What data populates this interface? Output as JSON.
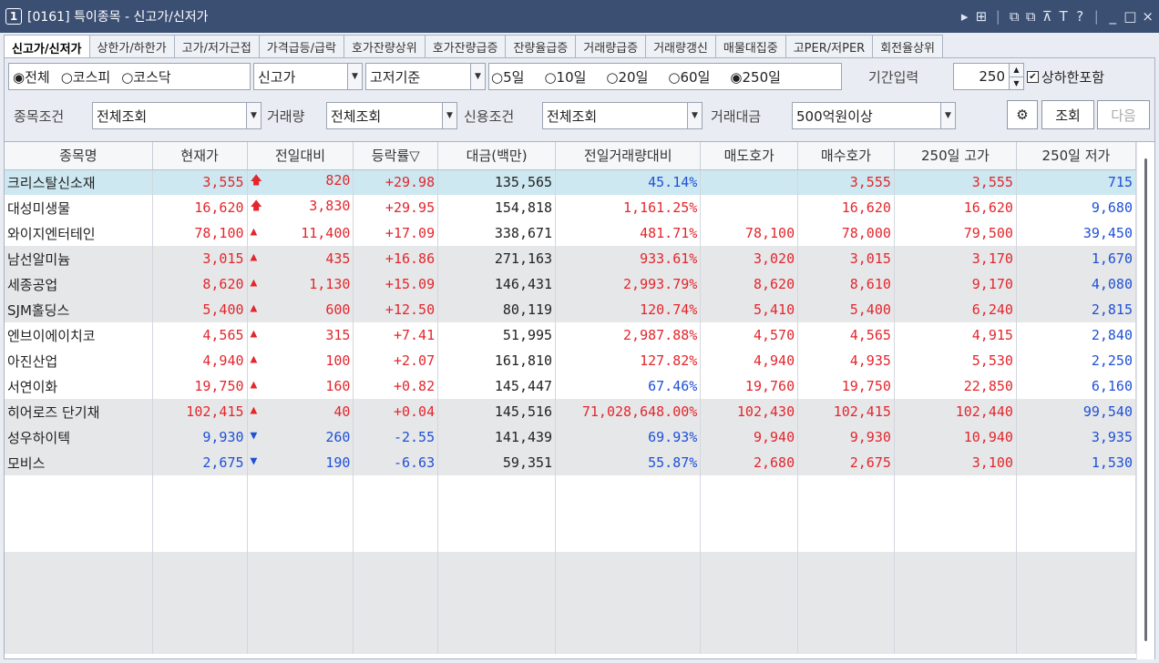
{
  "window": {
    "badge": "1",
    "title": "[0161] 특이종목 - 신고가/신저가",
    "controls": [
      "▸",
      "⊞",
      "⧉",
      "⧉",
      "⊼",
      "T",
      "?",
      "_",
      "□",
      "×"
    ]
  },
  "tabs": [
    "신고가/신저가",
    "상한가/하한가",
    "고가/저가근접",
    "가격급등/급락",
    "호가잔량상위",
    "호가잔량급증",
    "잔량율급증",
    "거래량급증",
    "거래량갱신",
    "매물대집중",
    "고PER/저PER",
    "회전율상위"
  ],
  "filters": {
    "market": [
      "◉전체",
      "○코스피",
      "○코스닥"
    ],
    "type_value": "신고가",
    "basis_value": "고저기준",
    "periods": [
      "○5일",
      "○10일",
      "○20일",
      "○60일",
      "◉250일"
    ],
    "period_label": "기간입력",
    "period_input": "250",
    "include_limit_label": "상하한포함",
    "include_limit_checked": "✔",
    "stock_cond_label": "종목조건",
    "stock_cond_value": "전체조회",
    "volume_label": "거래량",
    "volume_value": "전체조회",
    "credit_label": "신용조건",
    "credit_value": "전체조회",
    "amount_label": "거래대금",
    "amount_value": "500억원이상",
    "search_button": "조회",
    "next_button": "다음"
  },
  "table": {
    "columns": [
      "종목명",
      "현재가",
      "전일대비",
      "등락률▽",
      "대금(백만)",
      "전일거래량대비",
      "매도호가",
      "매수호가",
      "250일 고가",
      "250일 저가"
    ],
    "rows": [
      {
        "name": "크리스탈신소재",
        "price": "3,555",
        "arrow": "🡅",
        "change": "820",
        "rate": "+29.98",
        "amount": "135,565",
        "vol_ratio": "45.14%",
        "ask": "",
        "bid": "3,555",
        "high": "3,555",
        "low": "715",
        "price_c": "red",
        "vr_c": "blue",
        "style": "hl"
      },
      {
        "name": "대성미생물",
        "price": "16,620",
        "arrow": "🡅",
        "change": "3,830",
        "rate": "+29.95",
        "amount": "154,818",
        "vol_ratio": "1,161.25%",
        "ask": "",
        "bid": "16,620",
        "high": "16,620",
        "low": "9,680",
        "price_c": "red",
        "vr_c": "red",
        "style": ""
      },
      {
        "name": "와이지엔터테인",
        "price": "78,100",
        "arrow": "▲",
        "change": "11,400",
        "rate": "+17.09",
        "amount": "338,671",
        "vol_ratio": "481.71%",
        "ask": "78,100",
        "bid": "78,000",
        "high": "79,500",
        "low": "39,450",
        "price_c": "red",
        "vr_c": "red",
        "style": ""
      },
      {
        "name": "남선알미늄",
        "price": "3,015",
        "arrow": "▲",
        "change": "435",
        "rate": "+16.86",
        "amount": "271,163",
        "vol_ratio": "933.61%",
        "ask": "3,020",
        "bid": "3,015",
        "high": "3,170",
        "low": "1,670",
        "price_c": "red",
        "vr_c": "red",
        "style": "gray"
      },
      {
        "name": "세종공업",
        "price": "8,620",
        "arrow": "▲",
        "change": "1,130",
        "rate": "+15.09",
        "amount": "146,431",
        "vol_ratio": "2,993.79%",
        "ask": "8,620",
        "bid": "8,610",
        "high": "9,170",
        "low": "4,080",
        "price_c": "red",
        "vr_c": "red",
        "style": "gray"
      },
      {
        "name": "SJM홀딩스",
        "price": "5,400",
        "arrow": "▲",
        "change": "600",
        "rate": "+12.50",
        "amount": "80,119",
        "vol_ratio": "120.74%",
        "ask": "5,410",
        "bid": "5,400",
        "high": "6,240",
        "low": "2,815",
        "price_c": "red",
        "vr_c": "red",
        "style": "gray"
      },
      {
        "name": "엔브이에이치코",
        "price": "4,565",
        "arrow": "▲",
        "change": "315",
        "rate": "+7.41",
        "amount": "51,995",
        "vol_ratio": "2,987.88%",
        "ask": "4,570",
        "bid": "4,565",
        "high": "4,915",
        "low": "2,840",
        "price_c": "red",
        "vr_c": "red",
        "style": ""
      },
      {
        "name": "아진산업",
        "price": "4,940",
        "arrow": "▲",
        "change": "100",
        "rate": "+2.07",
        "amount": "161,810",
        "vol_ratio": "127.82%",
        "ask": "4,940",
        "bid": "4,935",
        "high": "5,530",
        "low": "2,250",
        "price_c": "red",
        "vr_c": "red",
        "style": ""
      },
      {
        "name": "서연이화",
        "price": "19,750",
        "arrow": "▲",
        "change": "160",
        "rate": "+0.82",
        "amount": "145,447",
        "vol_ratio": "67.46%",
        "ask": "19,760",
        "bid": "19,750",
        "high": "22,850",
        "low": "6,160",
        "price_c": "red",
        "vr_c": "blue",
        "style": ""
      },
      {
        "name": "히어로즈 단기채",
        "price": "102,415",
        "arrow": "▲",
        "change": "40",
        "rate": "+0.04",
        "amount": "145,516",
        "vol_ratio": "71,028,648.00%",
        "ask": "102,430",
        "bid": "102,415",
        "high": "102,440",
        "low": "99,540",
        "price_c": "red",
        "vr_c": "red",
        "style": "gray"
      },
      {
        "name": "성우하이텍",
        "price": "9,930",
        "arrow": "▼",
        "change": "260",
        "rate": "-2.55",
        "amount": "141,439",
        "vol_ratio": "69.93%",
        "ask": "9,940",
        "bid": "9,930",
        "high": "10,940",
        "low": "3,935",
        "price_c": "blue",
        "vr_c": "blue",
        "style": "gray"
      },
      {
        "name": "모비스",
        "price": "2,675",
        "arrow": "▼",
        "change": "190",
        "rate": "-6.63",
        "amount": "59,351",
        "vol_ratio": "55.87%",
        "ask": "2,680",
        "bid": "2,675",
        "high": "3,100",
        "low": "1,530",
        "price_c": "blue",
        "vr_c": "blue",
        "style": "gray"
      }
    ],
    "empty_rows": 7
  },
  "colors": {
    "up": "#e3262c",
    "down": "#1f50d6",
    "titlebar": "#3b4f73",
    "highlight": "#cde8f1"
  }
}
